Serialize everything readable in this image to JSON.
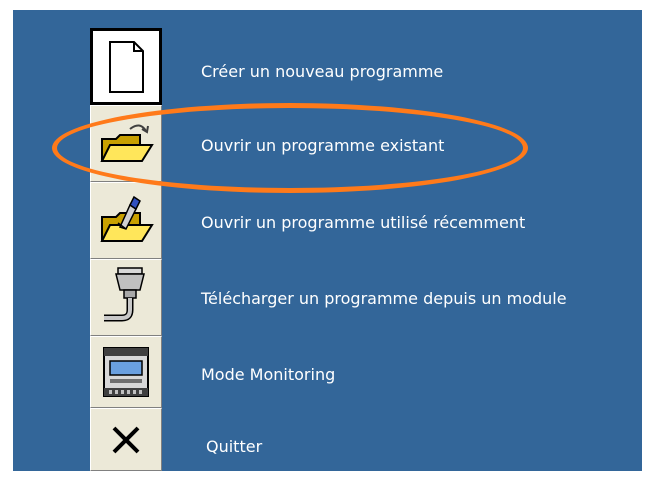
{
  "menu": {
    "items": [
      {
        "label": "Créer un nouveau programme",
        "icon": "new-document-icon"
      },
      {
        "label": "Ouvrir un programme existant",
        "icon": "open-folder-icon"
      },
      {
        "label": "Ouvrir un programme utilisé récemment",
        "icon": "open-recent-folder-icon"
      },
      {
        "label": "Télécharger un programme depuis un module",
        "icon": "serial-cable-icon"
      },
      {
        "label": "Mode Monitoring",
        "icon": "monitoring-module-icon"
      },
      {
        "label": "Quitter",
        "icon": "close-icon"
      }
    ]
  },
  "colors": {
    "panel_background": "#336699",
    "highlight_ellipse": "#ff7a1a",
    "label_text": "#ffffff",
    "tile_background": "#ece9d8"
  }
}
